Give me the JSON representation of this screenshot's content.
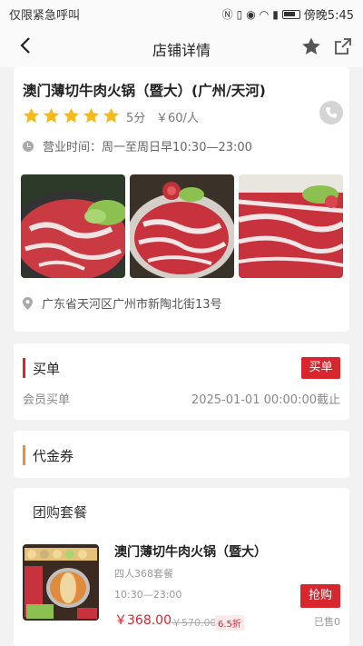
{
  "status_bar": {
    "carrier_text": "仅限紧急呼叫",
    "time": "傍晚5:45"
  },
  "nav": {
    "title": "店铺详情"
  },
  "shop": {
    "name": "澳门薄切牛肉火锅（暨大）(广州/天河)",
    "stars": 5,
    "rating_text": "5分",
    "price_text": "￥60/人",
    "hours": "营业时间：周一至周日早10:30—23:00",
    "address": "广东省天河区广州市新陶北街13号",
    "photos": [
      "beef-slices-photo-1",
      "beef-slices-photo-2",
      "beef-slices-photo-3"
    ]
  },
  "buy_section": {
    "title": "买单",
    "button": "买单",
    "member_label": "会员买单",
    "deadline": "2025-01-01 00:00:00截止"
  },
  "voucher_section": {
    "title": "代金券"
  },
  "group_section": {
    "title": "团购套餐",
    "package": {
      "name": "澳门薄切牛肉火锅（暨大）",
      "subtitle": "四人368套餐",
      "time": "10:30—23:00",
      "price": "￥368.00",
      "original_price": "￥570.00",
      "discount": "6.5折",
      "button": "抢购",
      "sold": "已售0"
    }
  },
  "colors": {
    "accent_red": "#d7262e",
    "star_yellow": "#f6b917",
    "voucher_bar": "#e8913b"
  }
}
